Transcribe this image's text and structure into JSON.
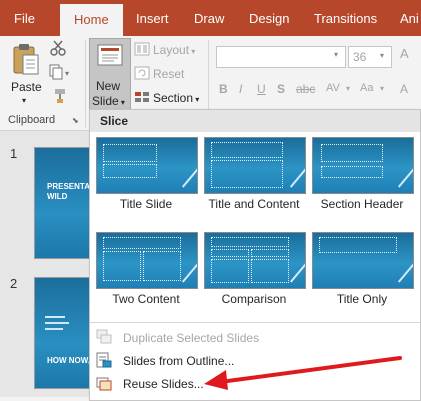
{
  "tabs": [
    {
      "label": "File",
      "active": false
    },
    {
      "label": "Home",
      "active": true
    },
    {
      "label": "Insert",
      "active": false
    },
    {
      "label": "Draw",
      "active": false
    },
    {
      "label": "Design",
      "active": false
    },
    {
      "label": "Transitions",
      "active": false
    },
    {
      "label": "Ani",
      "active": false
    }
  ],
  "ribbon": {
    "clipboard": {
      "paste_label": "Paste",
      "group_name": "Clipboard"
    },
    "slides": {
      "new_slide_line1": "New",
      "new_slide_line2": "Slide",
      "layout_label": "Layout",
      "reset_label": "Reset",
      "section_label": "Section"
    },
    "font": {
      "font_name_value": "",
      "font_size_value": "36"
    }
  },
  "slide_pane": {
    "slides": [
      {
        "number": "1",
        "title_text": "PRESENTA WILD"
      },
      {
        "number": "2",
        "title_text": "HOW NOW,"
      }
    ]
  },
  "dropdown": {
    "header": "Slice",
    "layouts": [
      {
        "label": "Title Slide",
        "icon": "layout-title-slide"
      },
      {
        "label": "Title and Content",
        "icon": "layout-title-content"
      },
      {
        "label": "Section Header",
        "icon": "layout-section-header"
      },
      {
        "label": "Two Content",
        "icon": "layout-two-content"
      },
      {
        "label": "Comparison",
        "icon": "layout-comparison"
      },
      {
        "label": "Title Only",
        "icon": "layout-title-only"
      }
    ],
    "menu": [
      {
        "label": "Duplicate Selected Slides",
        "enabled": false
      },
      {
        "label": "Slides from Outline...",
        "enabled": true
      },
      {
        "label": "Reuse Slides...",
        "enabled": true
      }
    ]
  },
  "colors": {
    "accent": "#b7472a",
    "annotation_arrow": "#e0191f",
    "slide_blue": "#2a8fc2"
  }
}
